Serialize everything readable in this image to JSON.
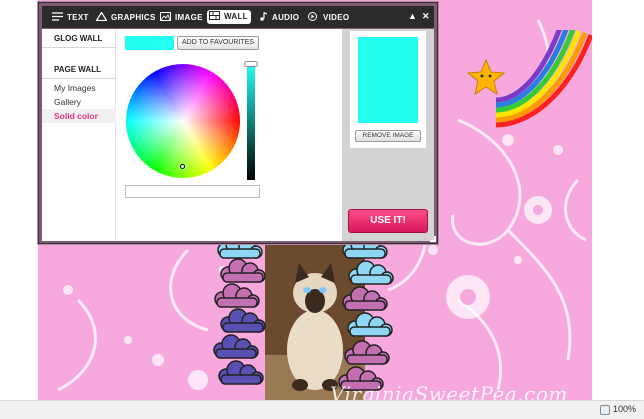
{
  "toolbar": {
    "items": [
      {
        "label": "TEXT",
        "icon": "lines-icon"
      },
      {
        "label": "GRAPHICS",
        "icon": "triangle-icon"
      },
      {
        "label": "IMAGE",
        "icon": "picture-icon"
      },
      {
        "label": "WALL",
        "icon": "wall-icon",
        "active": true
      },
      {
        "label": "AUDIO",
        "icon": "note-icon"
      },
      {
        "label": "VIDEO",
        "icon": "play-icon"
      }
    ],
    "collapse_glyph": "▲",
    "close_glyph": "✕"
  },
  "sidebar": {
    "glog_wall": "GLOG WALL",
    "page_wall": "PAGE WALL",
    "items": [
      "My Images",
      "Gallery",
      "Solid color"
    ],
    "selected": "Solid color"
  },
  "colorpicker": {
    "current_color": "#22fff0",
    "add_favourites_label": "ADD TO FAVOURITES",
    "hex_value": ""
  },
  "preview": {
    "remove_label": "REMOVE IMAGE",
    "use_label": "USE IT!"
  },
  "canvas": {
    "background_color": "#f7a9dd",
    "watermark": "VirginiaSweetPea.com"
  },
  "statusbar": {
    "zoom": "100%"
  },
  "colors": {
    "accent": "#e0357a",
    "use_button": "#e8226b",
    "toolbar": "#2b2b2b",
    "dialog_frame": "#7d5c74"
  }
}
